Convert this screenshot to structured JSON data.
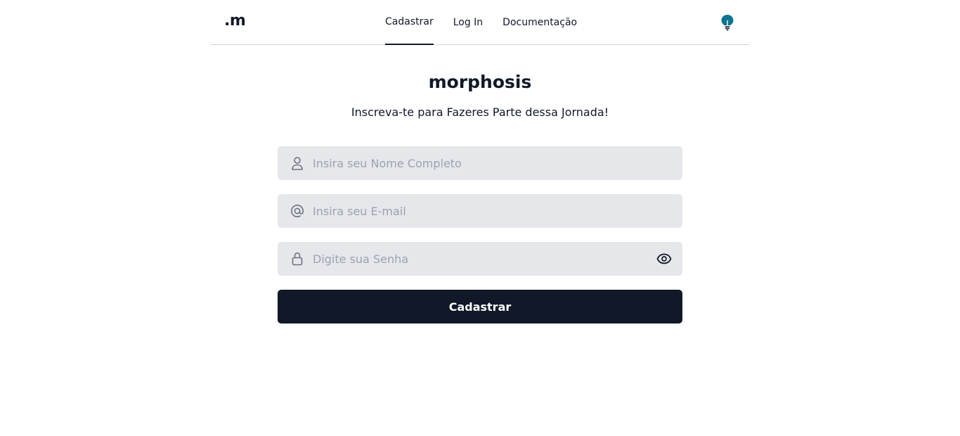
{
  "header": {
    "logo": ".m",
    "nav": [
      {
        "label": "Cadastrar",
        "active": true
      },
      {
        "label": "Log In",
        "active": false
      },
      {
        "label": "Documentação",
        "active": false
      }
    ],
    "theme_icon": "lightbulb-icon"
  },
  "main": {
    "title": "morphosis",
    "subtitle": "Inscreva-te para Fazeres Parte dessa Jornada!",
    "fields": {
      "name": {
        "placeholder": "Insira seu Nome Completo",
        "value": "",
        "icon": "user-icon"
      },
      "email": {
        "placeholder": "Insira seu E-mail",
        "value": "",
        "icon": "at-sign-icon"
      },
      "password": {
        "placeholder": "Digite sua Senha",
        "value": "",
        "icon": "lock-icon",
        "toggle_icon": "eye-icon"
      }
    },
    "submit_label": "Cadastrar"
  },
  "colors": {
    "primary": "#111827",
    "field_bg": "#e5e7eb",
    "placeholder": "#9ca3af",
    "accent": "#0e7490"
  }
}
